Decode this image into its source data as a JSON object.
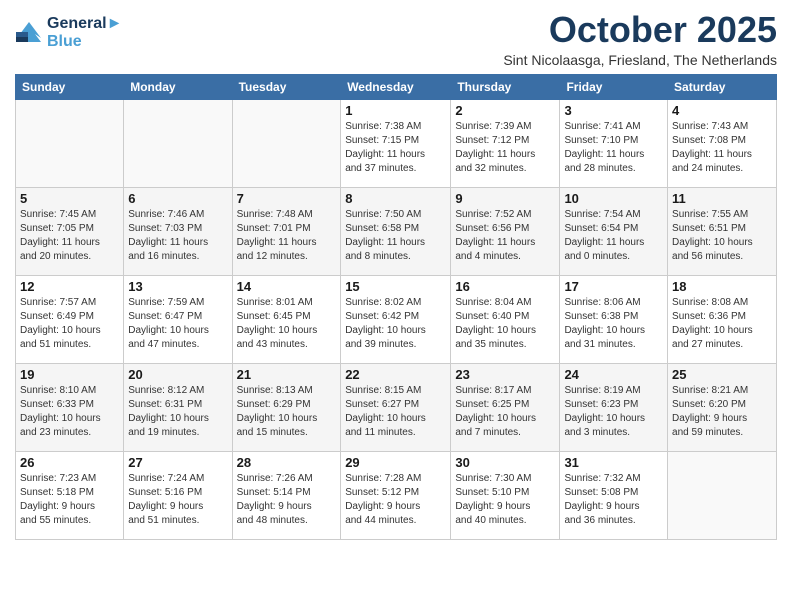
{
  "header": {
    "logo_line1": "General",
    "logo_line2": "Blue",
    "month": "October 2025",
    "location": "Sint Nicolaasga, Friesland, The Netherlands"
  },
  "weekdays": [
    "Sunday",
    "Monday",
    "Tuesday",
    "Wednesday",
    "Thursday",
    "Friday",
    "Saturday"
  ],
  "weeks": [
    [
      {
        "day": "",
        "info": ""
      },
      {
        "day": "",
        "info": ""
      },
      {
        "day": "",
        "info": ""
      },
      {
        "day": "1",
        "info": "Sunrise: 7:38 AM\nSunset: 7:15 PM\nDaylight: 11 hours\nand 37 minutes."
      },
      {
        "day": "2",
        "info": "Sunrise: 7:39 AM\nSunset: 7:12 PM\nDaylight: 11 hours\nand 32 minutes."
      },
      {
        "day": "3",
        "info": "Sunrise: 7:41 AM\nSunset: 7:10 PM\nDaylight: 11 hours\nand 28 minutes."
      },
      {
        "day": "4",
        "info": "Sunrise: 7:43 AM\nSunset: 7:08 PM\nDaylight: 11 hours\nand 24 minutes."
      }
    ],
    [
      {
        "day": "5",
        "info": "Sunrise: 7:45 AM\nSunset: 7:05 PM\nDaylight: 11 hours\nand 20 minutes."
      },
      {
        "day": "6",
        "info": "Sunrise: 7:46 AM\nSunset: 7:03 PM\nDaylight: 11 hours\nand 16 minutes."
      },
      {
        "day": "7",
        "info": "Sunrise: 7:48 AM\nSunset: 7:01 PM\nDaylight: 11 hours\nand 12 minutes."
      },
      {
        "day": "8",
        "info": "Sunrise: 7:50 AM\nSunset: 6:58 PM\nDaylight: 11 hours\nand 8 minutes."
      },
      {
        "day": "9",
        "info": "Sunrise: 7:52 AM\nSunset: 6:56 PM\nDaylight: 11 hours\nand 4 minutes."
      },
      {
        "day": "10",
        "info": "Sunrise: 7:54 AM\nSunset: 6:54 PM\nDaylight: 11 hours\nand 0 minutes."
      },
      {
        "day": "11",
        "info": "Sunrise: 7:55 AM\nSunset: 6:51 PM\nDaylight: 10 hours\nand 56 minutes."
      }
    ],
    [
      {
        "day": "12",
        "info": "Sunrise: 7:57 AM\nSunset: 6:49 PM\nDaylight: 10 hours\nand 51 minutes."
      },
      {
        "day": "13",
        "info": "Sunrise: 7:59 AM\nSunset: 6:47 PM\nDaylight: 10 hours\nand 47 minutes."
      },
      {
        "day": "14",
        "info": "Sunrise: 8:01 AM\nSunset: 6:45 PM\nDaylight: 10 hours\nand 43 minutes."
      },
      {
        "day": "15",
        "info": "Sunrise: 8:02 AM\nSunset: 6:42 PM\nDaylight: 10 hours\nand 39 minutes."
      },
      {
        "day": "16",
        "info": "Sunrise: 8:04 AM\nSunset: 6:40 PM\nDaylight: 10 hours\nand 35 minutes."
      },
      {
        "day": "17",
        "info": "Sunrise: 8:06 AM\nSunset: 6:38 PM\nDaylight: 10 hours\nand 31 minutes."
      },
      {
        "day": "18",
        "info": "Sunrise: 8:08 AM\nSunset: 6:36 PM\nDaylight: 10 hours\nand 27 minutes."
      }
    ],
    [
      {
        "day": "19",
        "info": "Sunrise: 8:10 AM\nSunset: 6:33 PM\nDaylight: 10 hours\nand 23 minutes."
      },
      {
        "day": "20",
        "info": "Sunrise: 8:12 AM\nSunset: 6:31 PM\nDaylight: 10 hours\nand 19 minutes."
      },
      {
        "day": "21",
        "info": "Sunrise: 8:13 AM\nSunset: 6:29 PM\nDaylight: 10 hours\nand 15 minutes."
      },
      {
        "day": "22",
        "info": "Sunrise: 8:15 AM\nSunset: 6:27 PM\nDaylight: 10 hours\nand 11 minutes."
      },
      {
        "day": "23",
        "info": "Sunrise: 8:17 AM\nSunset: 6:25 PM\nDaylight: 10 hours\nand 7 minutes."
      },
      {
        "day": "24",
        "info": "Sunrise: 8:19 AM\nSunset: 6:23 PM\nDaylight: 10 hours\nand 3 minutes."
      },
      {
        "day": "25",
        "info": "Sunrise: 8:21 AM\nSunset: 6:20 PM\nDaylight: 9 hours\nand 59 minutes."
      }
    ],
    [
      {
        "day": "26",
        "info": "Sunrise: 7:23 AM\nSunset: 5:18 PM\nDaylight: 9 hours\nand 55 minutes."
      },
      {
        "day": "27",
        "info": "Sunrise: 7:24 AM\nSunset: 5:16 PM\nDaylight: 9 hours\nand 51 minutes."
      },
      {
        "day": "28",
        "info": "Sunrise: 7:26 AM\nSunset: 5:14 PM\nDaylight: 9 hours\nand 48 minutes."
      },
      {
        "day": "29",
        "info": "Sunrise: 7:28 AM\nSunset: 5:12 PM\nDaylight: 9 hours\nand 44 minutes."
      },
      {
        "day": "30",
        "info": "Sunrise: 7:30 AM\nSunset: 5:10 PM\nDaylight: 9 hours\nand 40 minutes."
      },
      {
        "day": "31",
        "info": "Sunrise: 7:32 AM\nSunset: 5:08 PM\nDaylight: 9 hours\nand 36 minutes."
      },
      {
        "day": "",
        "info": ""
      }
    ]
  ]
}
